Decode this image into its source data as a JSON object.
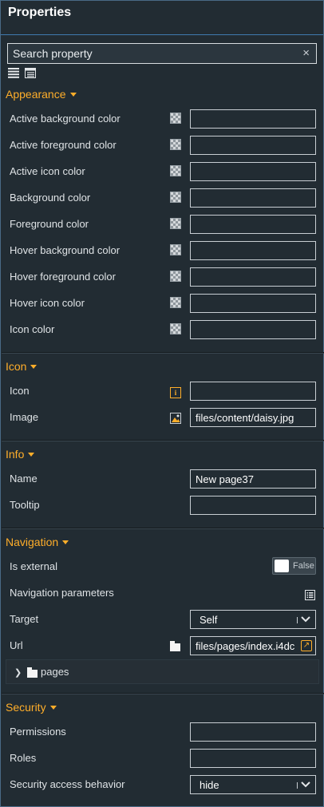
{
  "panel": {
    "title": "Properties"
  },
  "search": {
    "placeholder": "Search property",
    "clear_glyph": "×"
  },
  "view_buttons": [
    {
      "icon": "list-view-icon"
    },
    {
      "icon": "categorized-view-icon"
    }
  ],
  "sections": {
    "appearance": {
      "title": "Appearance",
      "rows": [
        {
          "label": "Active background color",
          "value": ""
        },
        {
          "label": "Active foreground color",
          "value": ""
        },
        {
          "label": "Active icon color",
          "value": ""
        },
        {
          "label": "Background color",
          "value": ""
        },
        {
          "label": "Foreground color",
          "value": ""
        },
        {
          "label": "Hover background color",
          "value": ""
        },
        {
          "label": "Hover foreground color",
          "value": ""
        },
        {
          "label": "Hover icon color",
          "value": ""
        },
        {
          "label": "Icon color",
          "value": ""
        }
      ]
    },
    "icon": {
      "title": "Icon",
      "rows": [
        {
          "label": "Icon",
          "value": "",
          "icon_glyph": "i"
        },
        {
          "label": "Image",
          "value": "files/content/daisy.jpg"
        }
      ]
    },
    "info": {
      "title": "Info",
      "rows": [
        {
          "label": "Name",
          "value": "New page37"
        },
        {
          "label": "Tooltip",
          "value": ""
        }
      ]
    },
    "navigation": {
      "title": "Navigation",
      "is_external": {
        "label": "Is external",
        "state": "False"
      },
      "navigation_parameters": {
        "label": "Navigation parameters"
      },
      "target": {
        "label": "Target",
        "value": "Self"
      },
      "url": {
        "label": "Url",
        "value": "files/pages/index.i4dc",
        "go_glyph": "↗"
      },
      "tree": {
        "label": "pages",
        "arrow": "❯"
      }
    },
    "security": {
      "title": "Security",
      "rows": [
        {
          "label": "Permissions",
          "value": ""
        },
        {
          "label": "Roles",
          "value": ""
        }
      ],
      "access_behavior": {
        "label": "Security access behavior",
        "value": "hide"
      }
    }
  },
  "colors": {
    "accent": "#ffae2a",
    "background": "#222c33",
    "header_border": "#3f7ab0"
  }
}
